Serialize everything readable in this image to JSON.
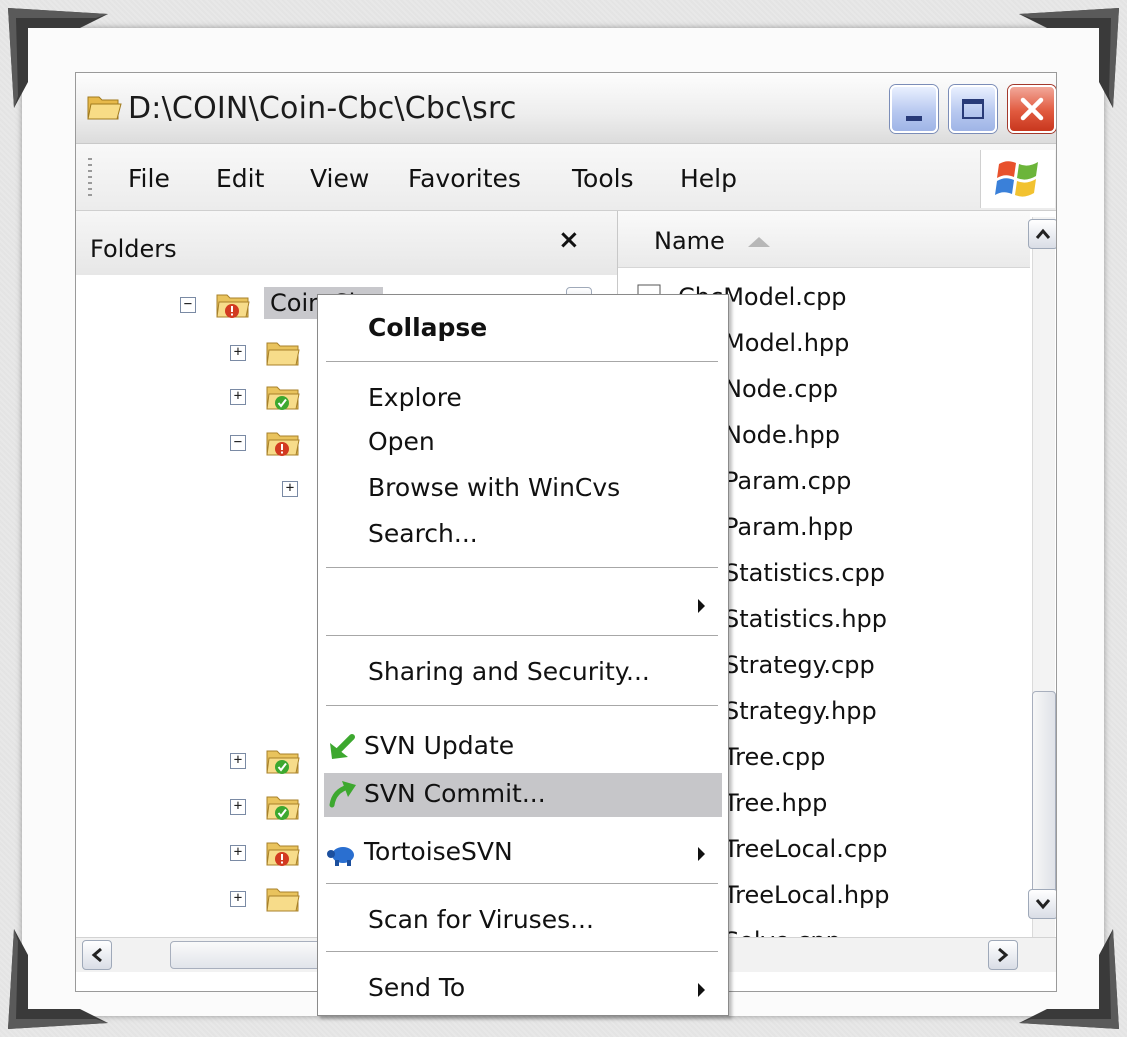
{
  "window": {
    "title": "D:\\COIN\\Coin-Cbc\\Cbc\\src"
  },
  "menubar": {
    "items": [
      "File",
      "Edit",
      "View",
      "Favorites",
      "Tools",
      "Help"
    ]
  },
  "folders_pane": {
    "header": "Folders",
    "close_glyph": "×",
    "selected_label": "Coin-Cbc"
  },
  "file_list": {
    "column_header": "Name",
    "files": [
      "CbcModel.cpp",
      "Model.hpp",
      "Node.cpp",
      "Node.hpp",
      "Param.cpp",
      "Param.hpp",
      "Statistics.cpp",
      "Statistics.hpp",
      "Strategy.cpp",
      "Strategy.hpp",
      "Tree.cpp",
      "Tree.hpp",
      "TreeLocal.cpp",
      "TreeLocal.hpp",
      "Solve.cpp"
    ]
  },
  "context_menu": {
    "items": [
      {
        "label": "Collapse",
        "bold": true
      },
      {
        "label": "Explore"
      },
      {
        "label": "Open"
      },
      {
        "label": "Browse with WinCvs"
      },
      {
        "label": "Search..."
      },
      {
        "label": "",
        "submenu": true
      },
      {
        "label": "Sharing and Security..."
      },
      {
        "label": "SVN Update",
        "icon": "svn-update-icon"
      },
      {
        "label": "SVN Commit...",
        "icon": "svn-commit-icon",
        "highlighted": true
      },
      {
        "label": "TortoiseSVN",
        "icon": "tortoisesvn-icon",
        "submenu": true
      },
      {
        "label": "Scan for Viruses..."
      },
      {
        "label": "Send To",
        "submenu": true
      }
    ]
  },
  "colors": {
    "menu_highlight": "#c6c6c9",
    "close_button": "#e15a3f",
    "svn_green": "#3da82f",
    "svn_conflict_red": "#d23a21",
    "folder_yellow": "#f5d270"
  }
}
